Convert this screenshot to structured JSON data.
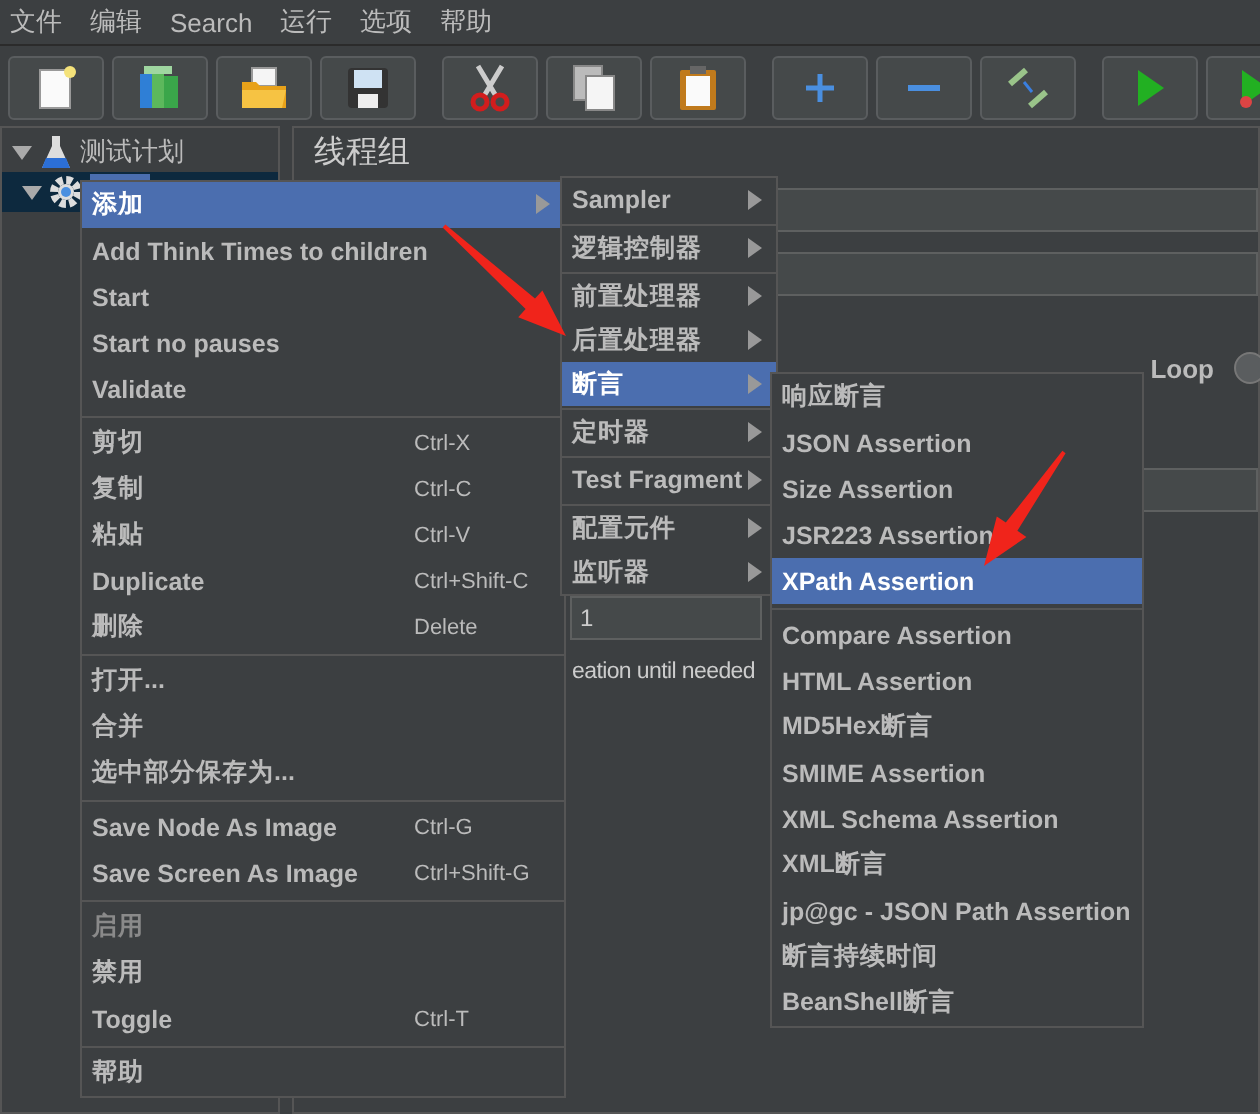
{
  "menu_bar": [
    "文件",
    "编辑",
    "Search",
    "运行",
    "选项",
    "帮助"
  ],
  "tree": [
    {
      "label": "测试计划",
      "expanded": true,
      "children": [
        {
          "kind": "thread-group",
          "expanded": true,
          "selected": true
        }
      ]
    }
  ],
  "panel": {
    "title": "线程组",
    "loop_label": "Loop",
    "loop_selected": false,
    "field_value": "1",
    "checkbox_label": "eation until needed"
  },
  "context_menu": [
    {
      "kind": "submenu",
      "label": "添加",
      "selected": true,
      "disabled": false
    },
    {
      "kind": "item",
      "label": "Add Think Times to children",
      "selected": false,
      "disabled": false
    },
    {
      "kind": "item",
      "label": "Start",
      "selected": false,
      "disabled": false
    },
    {
      "kind": "item",
      "label": "Start no pauses",
      "selected": false,
      "disabled": false
    },
    {
      "kind": "item",
      "label": "Validate",
      "selected": false,
      "disabled": false
    },
    {
      "kind": "separator"
    },
    {
      "kind": "item",
      "label": "剪切",
      "shortcut": "Ctrl-X",
      "selected": false,
      "disabled": false
    },
    {
      "kind": "item",
      "label": "复制",
      "shortcut": "Ctrl-C",
      "selected": false,
      "disabled": false
    },
    {
      "kind": "item",
      "label": "粘贴",
      "shortcut": "Ctrl-V",
      "selected": false,
      "disabled": false
    },
    {
      "kind": "item",
      "label": "Duplicate",
      "shortcut": "Ctrl+Shift-C",
      "selected": false,
      "disabled": false
    },
    {
      "kind": "item",
      "label": "删除",
      "shortcut": "Delete",
      "selected": false,
      "disabled": false
    },
    {
      "kind": "separator"
    },
    {
      "kind": "item",
      "label": "打开...",
      "selected": false,
      "disabled": false
    },
    {
      "kind": "item",
      "label": "合并",
      "selected": false,
      "disabled": false
    },
    {
      "kind": "item",
      "label": "选中部分保存为...",
      "selected": false,
      "disabled": false
    },
    {
      "kind": "separator"
    },
    {
      "kind": "item",
      "label": "Save Node As Image",
      "shortcut": "Ctrl-G",
      "selected": false,
      "disabled": false
    },
    {
      "kind": "item",
      "label": "Save Screen As Image",
      "shortcut": "Ctrl+Shift-G",
      "selected": false,
      "disabled": false
    },
    {
      "kind": "separator"
    },
    {
      "kind": "item",
      "label": "启用",
      "selected": false,
      "disabled": true
    },
    {
      "kind": "item",
      "label": "禁用",
      "selected": false,
      "disabled": false
    },
    {
      "kind": "item",
      "label": "Toggle",
      "shortcut": "Ctrl-T",
      "selected": false,
      "disabled": false
    },
    {
      "kind": "separator"
    },
    {
      "kind": "item",
      "label": "帮助",
      "selected": false,
      "disabled": false
    }
  ],
  "add_submenu": [
    {
      "kind": "submenu",
      "label": "Sampler",
      "selected": false
    },
    {
      "kind": "separator"
    },
    {
      "kind": "submenu",
      "label": "逻辑控制器",
      "selected": false
    },
    {
      "kind": "separator"
    },
    {
      "kind": "submenu",
      "label": "前置处理器",
      "selected": false
    },
    {
      "kind": "submenu",
      "label": "后置处理器",
      "selected": false
    },
    {
      "kind": "submenu",
      "label": "断言",
      "selected": true
    },
    {
      "kind": "separator"
    },
    {
      "kind": "submenu",
      "label": "定时器",
      "selected": false
    },
    {
      "kind": "separator"
    },
    {
      "kind": "submenu",
      "label": "Test Fragment",
      "selected": false
    },
    {
      "kind": "separator"
    },
    {
      "kind": "submenu",
      "label": "配置元件",
      "selected": false
    },
    {
      "kind": "submenu",
      "label": "监听器",
      "selected": false
    }
  ],
  "assertion_submenu": [
    {
      "kind": "item",
      "label": "响应断言",
      "selected": false
    },
    {
      "kind": "item",
      "label": "JSON Assertion",
      "selected": false
    },
    {
      "kind": "item",
      "label": "Size Assertion",
      "selected": false
    },
    {
      "kind": "item",
      "label": "JSR223 Assertion",
      "selected": false
    },
    {
      "kind": "item",
      "label": "XPath Assertion",
      "selected": true
    },
    {
      "kind": "separator"
    },
    {
      "kind": "item",
      "label": "Compare Assertion",
      "selected": false
    },
    {
      "kind": "item",
      "label": "HTML Assertion",
      "selected": false
    },
    {
      "kind": "item",
      "label": "MD5Hex断言",
      "selected": false
    },
    {
      "kind": "item",
      "label": "SMIME Assertion",
      "selected": false
    },
    {
      "kind": "item",
      "label": "XML Schema Assertion",
      "selected": false
    },
    {
      "kind": "item",
      "label": "XML断言",
      "selected": false
    },
    {
      "kind": "item",
      "label": "jp@gc - JSON Path Assertion",
      "selected": false
    },
    {
      "kind": "item",
      "label": "断言持续时间",
      "selected": false
    },
    {
      "kind": "item",
      "label": "BeanShell断言",
      "selected": false
    }
  ]
}
